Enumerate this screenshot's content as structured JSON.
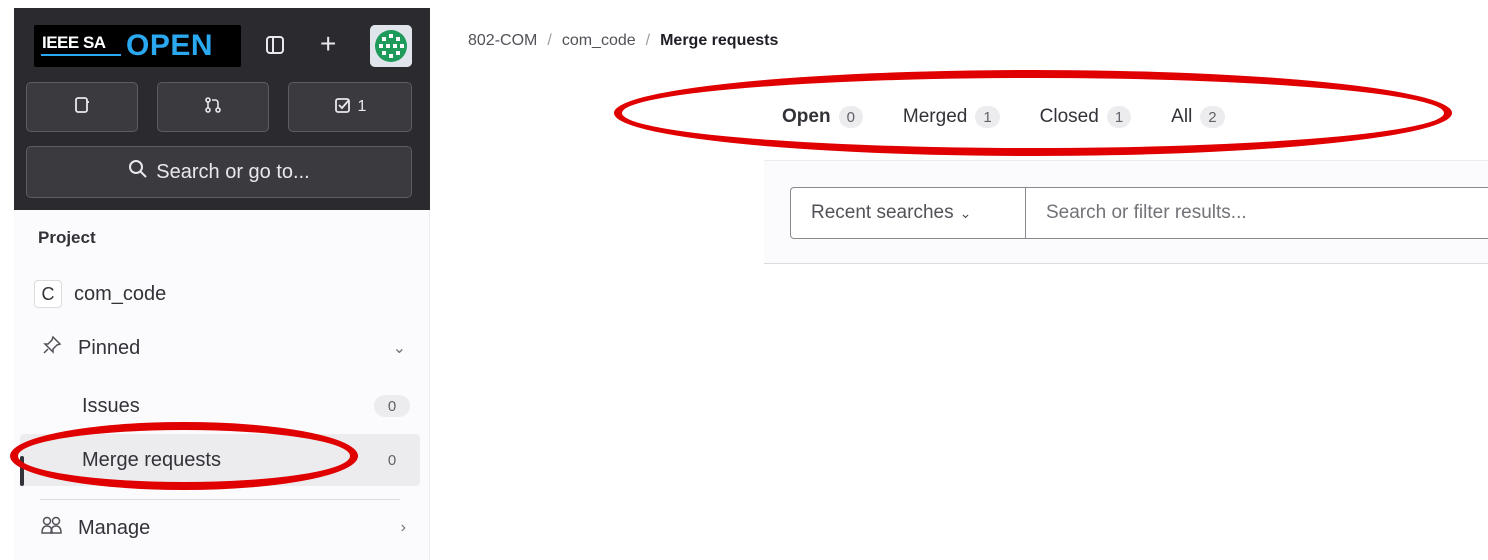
{
  "sidebar": {
    "logo": {
      "line1": "IEEE SA",
      "line2": "OPEN"
    },
    "top_icons": [
      "panel-toggle-icon",
      "plus-icon"
    ],
    "buttons": [
      {
        "icon": "issues-icon",
        "label": ""
      },
      {
        "icon": "merge-request-icon",
        "label": ""
      },
      {
        "icon": "todo-icon",
        "label": "1"
      }
    ],
    "search_label": "Search or go to...",
    "section_heading": "Project",
    "project": {
      "badge": "C",
      "name": "com_code"
    },
    "pinned_label": "Pinned",
    "items": [
      {
        "label": "Issues",
        "count": "0"
      },
      {
        "label": "Merge requests",
        "count": "0"
      }
    ],
    "manage_label": "Manage"
  },
  "breadcrumb": {
    "group": "802-COM",
    "project": "com_code",
    "current": "Merge requests"
  },
  "tabs": [
    {
      "label": "Open",
      "count": "0"
    },
    {
      "label": "Merged",
      "count": "1"
    },
    {
      "label": "Closed",
      "count": "1"
    },
    {
      "label": "All",
      "count": "2"
    }
  ],
  "filter": {
    "recent_label": "Recent searches",
    "placeholder": "Search or filter results..."
  },
  "colors": {
    "annotation": "#e00000",
    "sidebar_dark": "#2b2b2f",
    "brand_blue": "#2aa8f0"
  }
}
